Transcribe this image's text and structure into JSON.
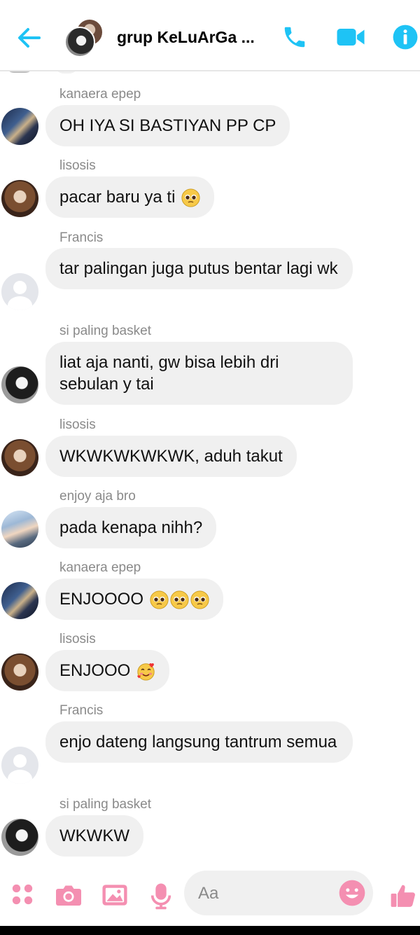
{
  "header": {
    "title": "grup KeLuArGa ...",
    "back_icon": "arrow-left-icon",
    "call_icon": "phone-icon",
    "video_icon": "video-camera-icon",
    "info_icon": "info-icon"
  },
  "messages": [
    {
      "sender": "kanaera epep",
      "text": "OH IYA SI BASTIYAN PP CP",
      "emoji": ""
    },
    {
      "sender": "lisosis",
      "text": "pacar baru ya ti ",
      "emoji": "pleading-face"
    },
    {
      "sender": "Francis",
      "text": "tar palingan juga putus bentar lagi wk",
      "emoji": ""
    },
    {
      "sender": "si paling basket",
      "text": "liat aja nanti, gw bisa lebih dri sebulan y tai",
      "emoji": ""
    },
    {
      "sender": "lisosis",
      "text": "WKWKWKWKWK, aduh takut",
      "emoji": ""
    },
    {
      "sender": "enjoy aja bro",
      "text": "pada kenapa nihh?",
      "emoji": ""
    },
    {
      "sender": "kanaera epep",
      "text": "ENJOOOO ",
      "emoji": "pleading-face x3"
    },
    {
      "sender": "lisosis",
      "text": "ENJOOO ",
      "emoji": "smiling-face-with-hearts"
    },
    {
      "sender": "Francis",
      "text": "enjo dateng langsung tantrum semua",
      "emoji": ""
    },
    {
      "sender": "si paling basket",
      "text": "WKWKW",
      "emoji": ""
    }
  ],
  "composer": {
    "placeholder": "Aa",
    "menu_icon": "four-dots-icon",
    "camera_icon": "camera-icon",
    "gallery_icon": "image-icon",
    "mic_icon": "microphone-icon",
    "emoji_icon": "smiley-icon",
    "like_icon": "thumbs-up-icon"
  },
  "colors": {
    "header_accent": "#1ec3f5",
    "composer_accent": "#f48fb1",
    "bubble": "#f0f0f0",
    "sender_text": "#8a8a8a"
  }
}
